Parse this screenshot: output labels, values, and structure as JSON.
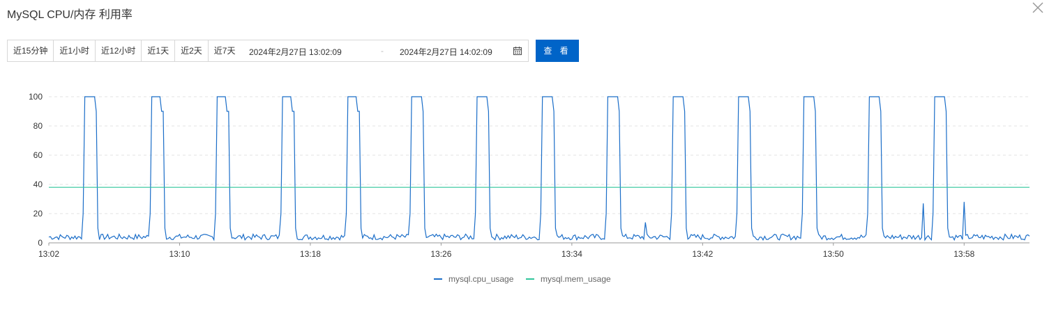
{
  "header": {
    "title": "MySQL CPU/内存 利用率"
  },
  "toolbar": {
    "ranges": [
      "近15分钟",
      "近1小时",
      "近12小时",
      "近1天",
      "近2天",
      "近7天"
    ],
    "start_time": "2024年2月27日 13:02:09",
    "separator": "-",
    "end_time": "2024年2月27日 14:02:09",
    "view_label": "查 看"
  },
  "chart_data": {
    "type": "line",
    "xlabel": "",
    "ylabel": "",
    "x_range_minutes": [
      0,
      60
    ],
    "xticks": [
      "13:02",
      "13:10",
      "13:18",
      "13:26",
      "13:34",
      "13:42",
      "13:50",
      "13:58"
    ],
    "ylim": [
      0,
      100
    ],
    "yticks": [
      0,
      20,
      40,
      60,
      80,
      100
    ],
    "grid": "horizontal dashed",
    "legend_placement": "bottom-center",
    "series": [
      {
        "name": "mysql.cpu_usage",
        "color": "#1a6dc8",
        "description": "baseline ~2-6% with periodic spikes to 100% lasting ~0.8 min roughly every 4 min",
        "spikes": [
          {
            "start": 2.2,
            "end": 3.0
          },
          {
            "start": 6.2,
            "end": 7.0
          },
          {
            "start": 10.2,
            "end": 11.0
          },
          {
            "start": 14.2,
            "end": 15.0
          },
          {
            "start": 18.2,
            "end": 19.0
          },
          {
            "start": 22.2,
            "end": 23.0
          },
          {
            "start": 26.2,
            "end": 27.0
          },
          {
            "start": 30.2,
            "end": 31.0
          },
          {
            "start": 34.2,
            "end": 35.0
          },
          {
            "start": 38.2,
            "end": 39.0
          },
          {
            "start": 42.2,
            "end": 43.0
          },
          {
            "start": 46.2,
            "end": 47.0
          },
          {
            "start": 50.2,
            "end": 51.0
          },
          {
            "start": 54.2,
            "end": 55.0
          }
        ],
        "baseline_min": 2,
        "baseline_max": 6,
        "minor_peaks": [
          {
            "x": 36.5,
            "y": 14
          },
          {
            "x": 53.5,
            "y": 27
          },
          {
            "x": 56.0,
            "y": 28
          }
        ]
      },
      {
        "name": "mysql.mem_usage",
        "color": "#2fc59a",
        "value": 38
      }
    ]
  },
  "legend": [
    {
      "label": "mysql.cpu_usage",
      "color": "#1a6dc8"
    },
    {
      "label": "mysql.mem_usage",
      "color": "#2fc59a"
    }
  ]
}
